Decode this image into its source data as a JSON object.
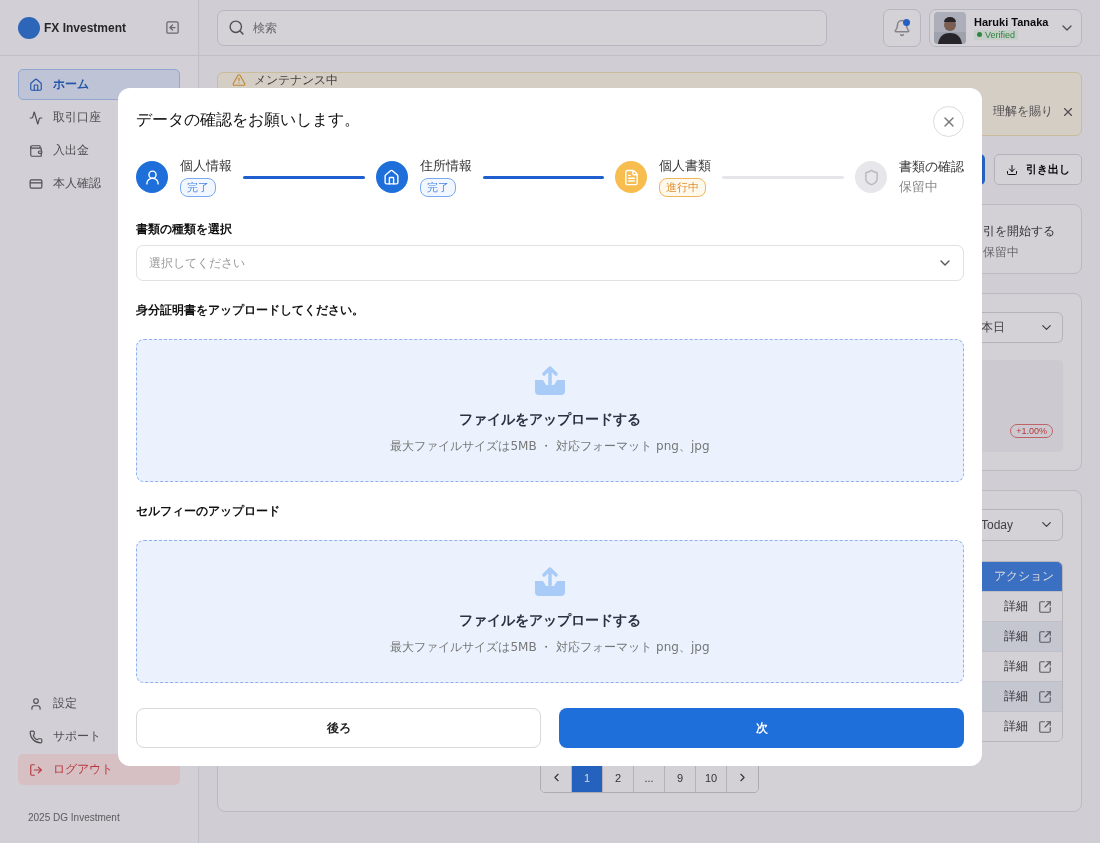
{
  "sidebar": {
    "brand": "FX Investment",
    "nav": [
      {
        "label": "ホーム",
        "selected": true
      },
      {
        "label": "取引口座",
        "selected": false
      },
      {
        "label": "入出金",
        "selected": false
      },
      {
        "label": "本人確認",
        "selected": false
      }
    ],
    "bottom_nav": [
      {
        "label": "設定",
        "kind": "normal"
      },
      {
        "label": "サポート",
        "kind": "normal"
      },
      {
        "label": "ログアウト",
        "kind": "danger"
      }
    ],
    "footer": "2025 DG Investment"
  },
  "header": {
    "search": {
      "placeholder": "検索"
    },
    "notifications": {
      "unread": true
    },
    "user": {
      "name": "Haruki Tanaka",
      "status": "Verified"
    }
  },
  "alert": {
    "title": "メンテナンス中",
    "message": "理解を賜り"
  },
  "actions": {
    "withdraw": "引き出し"
  },
  "account_card": {
    "title": "引を開始する",
    "status": "保留中"
  },
  "performance": {
    "period": "本日",
    "change": "+1.00%"
  },
  "transactions": {
    "period": "Today",
    "columns": [
      "アクション"
    ],
    "rows": [
      {
        "action": "詳細"
      },
      {
        "action": "詳細"
      },
      {
        "action": "詳細"
      },
      {
        "action": "詳細"
      },
      {
        "action": "詳細"
      }
    ]
  },
  "pagination": {
    "pages": [
      {
        "label": "1",
        "selected": true
      },
      {
        "label": "2",
        "selected": false
      },
      {
        "label": "...",
        "selected": false
      },
      {
        "label": "9",
        "selected": false
      },
      {
        "label": "10",
        "selected": false
      }
    ]
  },
  "modal": {
    "title": "データの確認をお願いします。",
    "steps": [
      {
        "label": "個人情報",
        "kind": "done",
        "status_label": "完了"
      },
      {
        "label": "住所情報",
        "kind": "done",
        "status_label": "完了"
      },
      {
        "label": "個人書類",
        "kind": "active",
        "status_label": "進行中"
      },
      {
        "label": "書類の確認",
        "kind": "pending",
        "status_label": "保留中"
      }
    ],
    "document_type": {
      "label": "書類の種類を選択",
      "placeholder": "選択してください"
    },
    "uploads": [
      {
        "label": "身分証明書をアップロードしてください。",
        "title": "ファイルをアップロードする",
        "hint": "最大ファイルサイズは5MB ・ 対応フォーマット png、jpg"
      },
      {
        "label": "セルフィーのアップロード",
        "title": "ファイルをアップロードする",
        "hint": "最大ファイルサイズは5MB ・ 対応フォーマット png、jpg"
      }
    ],
    "buttons": {
      "back": "後ろ",
      "next": "次"
    }
  }
}
